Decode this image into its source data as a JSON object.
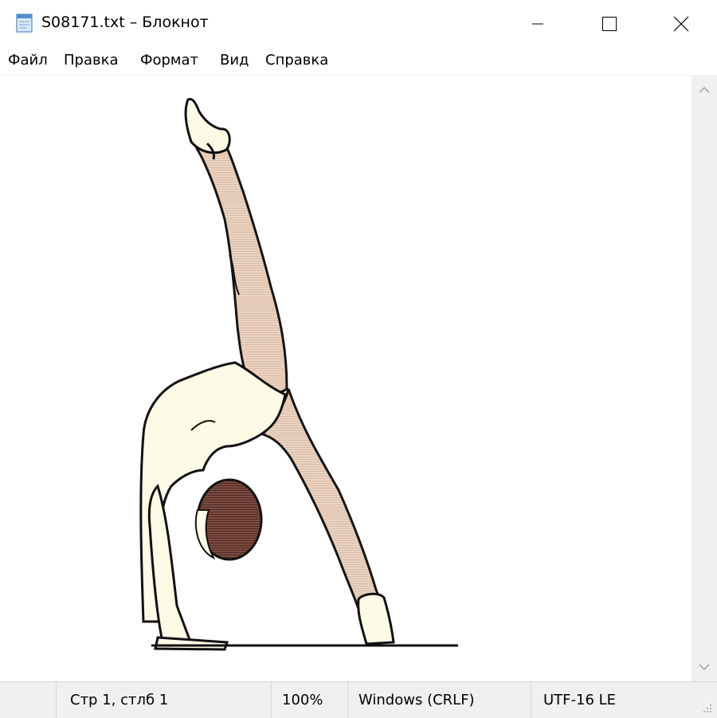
{
  "window": {
    "title": "S08171.txt – Блокнот",
    "app_icon": "notepad-icon"
  },
  "controls": {
    "minimize_icon": "minimize-icon",
    "maximize_icon": "maximize-icon",
    "close_icon": "close-icon"
  },
  "menu": {
    "items": [
      "Файл",
      "Правка",
      "Формат",
      "Вид",
      "Справка"
    ]
  },
  "document": {
    "content_type": "ascii-art-drawing",
    "subject": "gymnast-backbend-illustration"
  },
  "statusbar": {
    "position": "Стр 1, стлб 1",
    "zoom": "100%",
    "line_endings": "Windows (CRLF)",
    "encoding": "UTF-16 LE"
  },
  "colors": {
    "skin": "#ecd3c0",
    "leotard": "#fdfbe6",
    "hair": "#7d4b40",
    "outline": "#111111",
    "chrome": "#f0f0f0"
  }
}
